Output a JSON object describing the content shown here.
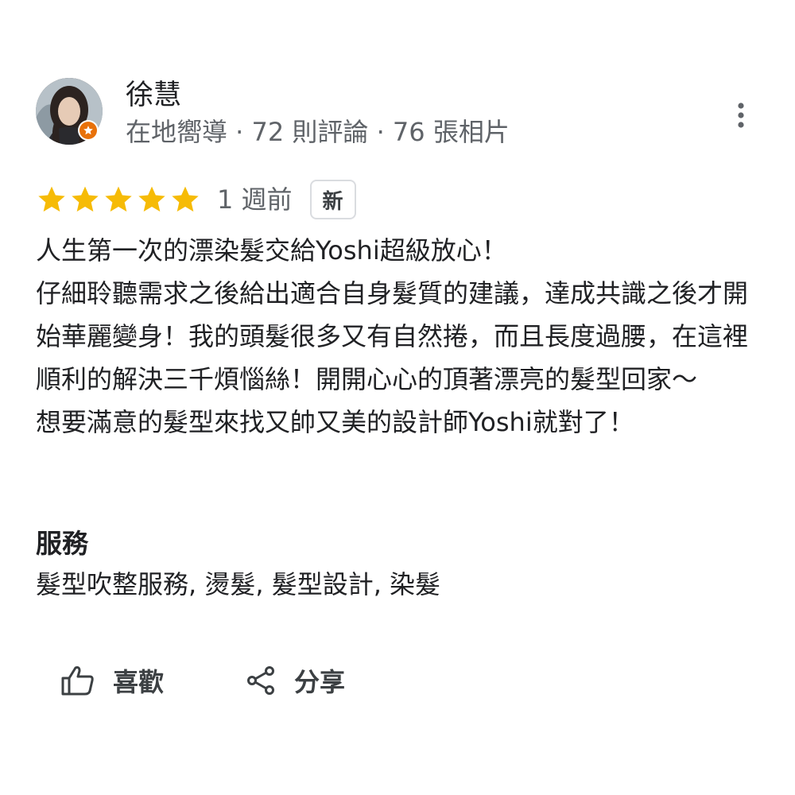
{
  "reviewer": {
    "name": "徐慧",
    "meta": "在地嚮導 · 72 則評論 · 76 張相片"
  },
  "rating": {
    "stars": 5,
    "max": 5,
    "color": "#f6bb06",
    "time": "1 週前",
    "badge": "新"
  },
  "review": {
    "lines": [
      "人生第一次的漂染髮交給Yoshi超級放心！",
      "仔細聆聽需求之後給出適合自身髮質的建議，達成共識之後才開始華麗變身！我的頭髮很多又有自然捲，而且長度過腰，在這裡順利的解決三千煩惱絲！開開心心的頂著漂亮的髮型回家～",
      "想要滿意的髮型來找又帥又美的設計師Yoshi就對了！"
    ]
  },
  "services": {
    "heading": "服務",
    "list": "髮型吹整服務, 燙髮, 髮型設計, 染髮"
  },
  "actions": {
    "like_label": "喜歡",
    "share_label": "分享"
  },
  "icons": {
    "more": "more-vert-icon",
    "like": "thumb-up-icon",
    "share": "share-icon",
    "badge": "local-guide-icon"
  }
}
